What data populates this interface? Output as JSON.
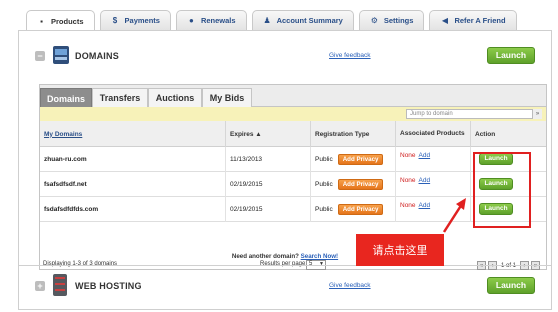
{
  "top_tabs": [
    {
      "label": "Products",
      "icon": "box-icon",
      "active": true
    },
    {
      "label": "Payments",
      "icon": "dollar-icon",
      "active": false
    },
    {
      "label": "Renewals",
      "icon": "info-icon",
      "active": false
    },
    {
      "label": "Account Summary",
      "icon": "person-icon",
      "active": false
    },
    {
      "label": "Settings",
      "icon": "gear-icon",
      "active": false
    },
    {
      "label": "Refer A Friend",
      "icon": "megaphone-icon",
      "active": false
    }
  ],
  "domains_section": {
    "toggle": "−",
    "title": "DOMAINS",
    "feedback": "Give feedback",
    "launch": "Launch"
  },
  "domain_tabs": [
    "Domains",
    "Transfers",
    "Auctions",
    "My Bids"
  ],
  "search": {
    "placeholder": "Jump to domain",
    "button": "»"
  },
  "table": {
    "headers": [
      "My Domains",
      "Expires ▲",
      "Registration Type",
      "Associated Products",
      "Action"
    ],
    "rows": [
      {
        "domain": "zhuan-ru.com",
        "expires": "11/13/2013",
        "type": "Public",
        "privacy": "Add Privacy",
        "assoc": "None",
        "add": "Add",
        "action": "Launch"
      },
      {
        "domain": "fsafsdfsdf.net",
        "expires": "02/19/2015",
        "type": "Public",
        "privacy": "Add Privacy",
        "assoc": "None",
        "add": "Add",
        "action": "Launch"
      },
      {
        "domain": "fsdafsdfdfds.com",
        "expires": "02/19/2015",
        "type": "Public",
        "privacy": "Add Privacy",
        "assoc": "None",
        "add": "Add",
        "action": "Launch"
      }
    ]
  },
  "footer": {
    "displaying": "Displaying 1-3 of 3 domains",
    "results_label": "Results per page:",
    "results_value": "5",
    "page_text": "1 of 1"
  },
  "need_domain": {
    "text": "Need another domain?",
    "link": "Search Now!"
  },
  "web_hosting": {
    "toggle": "+",
    "title": "WEB HOSTING",
    "feedback": "Give feedback",
    "launch": "Launch"
  },
  "annotation": {
    "callout": "请点击这里"
  },
  "colors": {
    "launch_green": "#6ab130",
    "privacy_orange": "#ec8a2c",
    "annotation_red": "#e8261f"
  }
}
